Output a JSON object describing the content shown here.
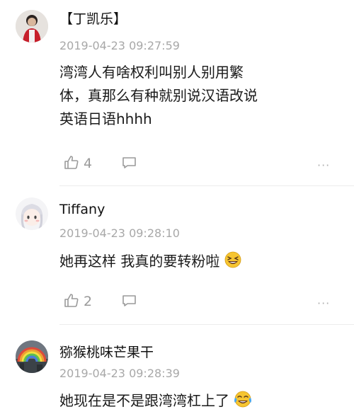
{
  "comments": [
    {
      "name": "【丁凯乐】",
      "time": "2019-04-23 09:27:59",
      "lines": [
        "湾湾人有啥权利叫别人别用繁",
        "体，真那么有种就别说汉语改说",
        "英语日语hhhh"
      ],
      "likes": "4",
      "more": "···"
    },
    {
      "name": "Tiffany",
      "time": "2019-04-23 09:28:10",
      "text": "她再这样 我真的要转粉啦",
      "emoji": "laughing-face",
      "likes": "2",
      "more": "···"
    },
    {
      "name": "猕猴桃味芒果干",
      "time": "2019-04-23 09:28:39",
      "text": "她现在是不是跟湾湾杠上了",
      "emoji": "tears-of-joy-face"
    }
  ],
  "colors": {
    "meta": "#a8a8a8",
    "icon": "#9a9a9a",
    "text": "#1a1a1a"
  }
}
